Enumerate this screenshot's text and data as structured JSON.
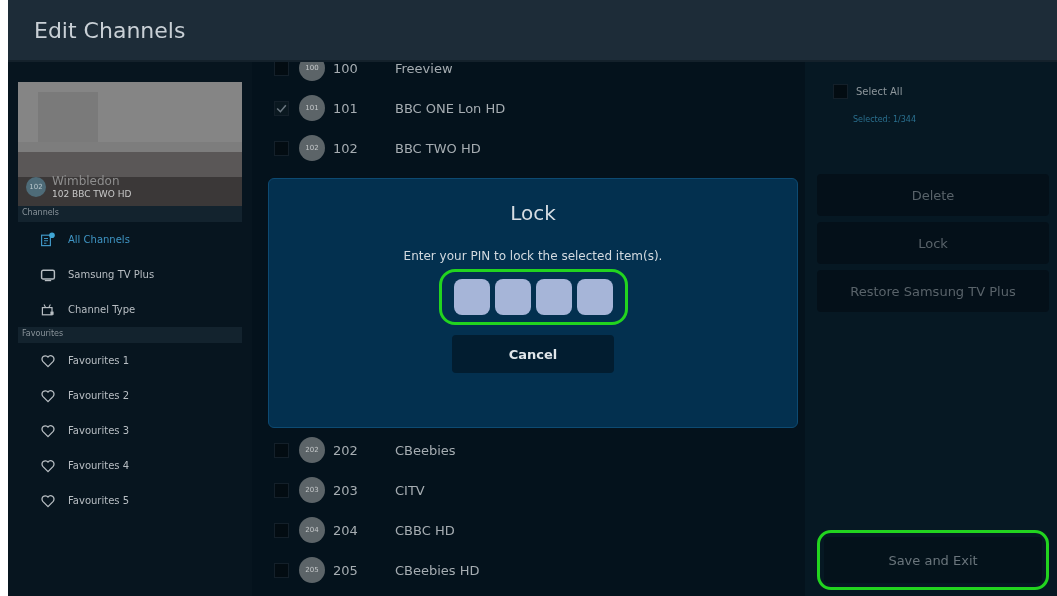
{
  "header": {
    "title": "Edit Channels"
  },
  "preview": {
    "badge": "102",
    "show": "Wimbledon",
    "channel": "102 BBC TWO HD"
  },
  "sidebar": {
    "sections": [
      {
        "title": "Channels",
        "items": [
          {
            "label": "All Channels",
            "kind": "list",
            "selected": true
          },
          {
            "label": "Samsung TV Plus",
            "kind": "tv",
            "selected": false
          },
          {
            "label": "Channel Type",
            "kind": "type",
            "selected": false
          }
        ]
      },
      {
        "title": "Favourites",
        "items": [
          {
            "label": "Favourites 1",
            "kind": "heart",
            "selected": false
          },
          {
            "label": "Favourites 2",
            "kind": "heart",
            "selected": false
          },
          {
            "label": "Favourites 3",
            "kind": "heart",
            "selected": false
          },
          {
            "label": "Favourites 4",
            "kind": "heart",
            "selected": false
          },
          {
            "label": "Favourites 5",
            "kind": "heart",
            "selected": false
          }
        ]
      }
    ]
  },
  "channels_top": [
    {
      "logo": "100",
      "number": "100",
      "name": "Freeview",
      "checked": false
    },
    {
      "logo": "101",
      "number": "101",
      "name": "BBC ONE Lon HD",
      "checked": true
    },
    {
      "logo": "102",
      "number": "102",
      "name": "BBC TWO HD",
      "checked": false
    }
  ],
  "channels_bottom": [
    {
      "logo": "202",
      "number": "202",
      "name": "CBeebies",
      "checked": false
    },
    {
      "logo": "203",
      "number": "203",
      "name": "CITV",
      "checked": false
    },
    {
      "logo": "204",
      "number": "204",
      "name": "CBBC HD",
      "checked": false
    },
    {
      "logo": "205",
      "number": "205",
      "name": "CBeebies HD",
      "checked": false
    }
  ],
  "right_panel": {
    "select_all": {
      "label": "Select All",
      "checked": false
    },
    "selected_count": "Selected: 1/344",
    "buttons": [
      {
        "label": "Delete"
      },
      {
        "label": "Lock"
      },
      {
        "label": "Restore Samsung TV Plus"
      }
    ],
    "save": {
      "label": "Save and Exit",
      "highlighted": true
    }
  },
  "dialog": {
    "title": "Lock",
    "message": "Enter your PIN to lock the selected item(s).",
    "pin": {
      "highlighted": true
    },
    "cancel": "Cancel"
  }
}
